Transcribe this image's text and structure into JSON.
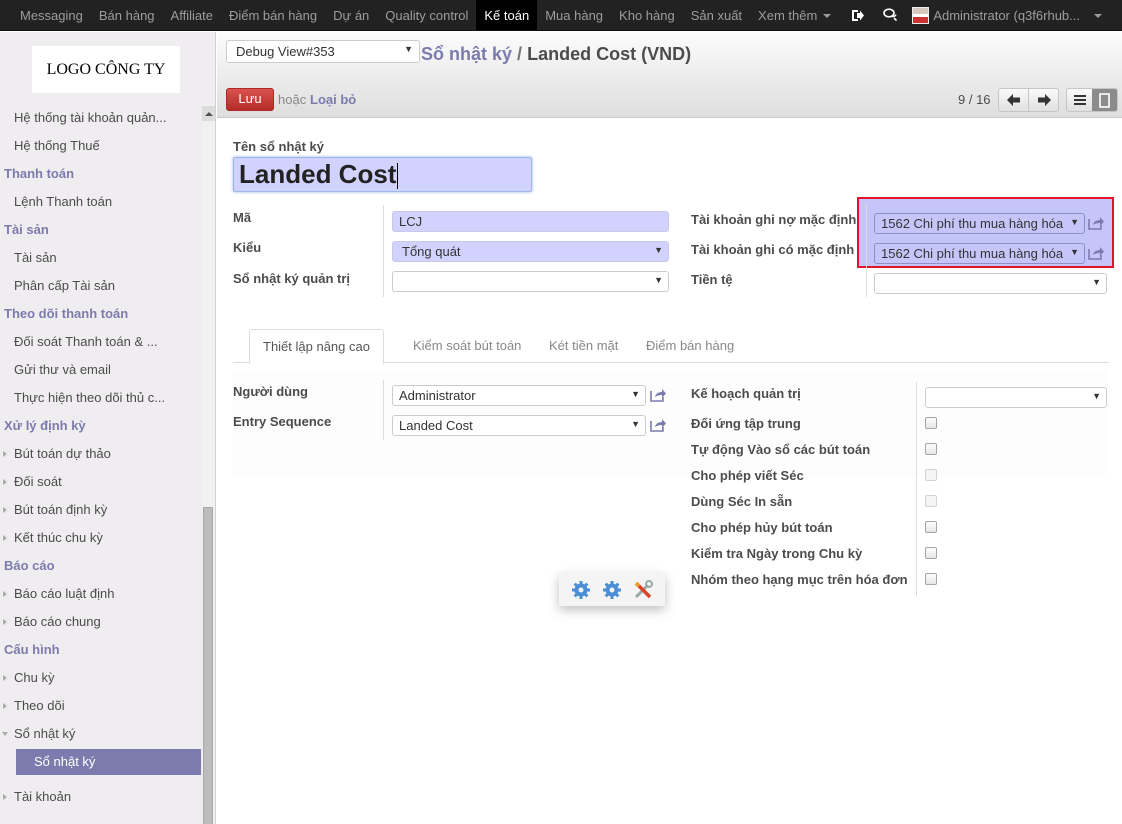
{
  "topnav": {
    "items": [
      {
        "label": "Messaging",
        "active": false
      },
      {
        "label": "Bán hàng",
        "active": false
      },
      {
        "label": "Affiliate",
        "active": false
      },
      {
        "label": "Điểm bán hàng",
        "active": false
      },
      {
        "label": "Dự án",
        "active": false
      },
      {
        "label": "Quality control",
        "active": false
      },
      {
        "label": "Kế toán",
        "active": true
      },
      {
        "label": "Mua hàng",
        "active": false
      },
      {
        "label": "Kho hàng",
        "active": false
      },
      {
        "label": "Sản xuất",
        "active": false
      },
      {
        "label": "Xem thêm",
        "active": false,
        "dropdown": true
      }
    ],
    "user_label": "Administrator (q3f6rhub...",
    "icons": [
      "sign-out-icon",
      "chat-icon"
    ]
  },
  "sidebar": {
    "logo_text": "LOGO CÔNG TY",
    "items": [
      {
        "type": "item",
        "label": "Hệ thống tài khoản quản..."
      },
      {
        "type": "item",
        "label": "Hệ thống Thuế"
      },
      {
        "type": "section",
        "label": "Thanh toán"
      },
      {
        "type": "item",
        "label": "Lệnh Thanh toán"
      },
      {
        "type": "section",
        "label": "Tài sản"
      },
      {
        "type": "item",
        "label": "Tài sản"
      },
      {
        "type": "item",
        "label": "Phân cấp Tài sản"
      },
      {
        "type": "section",
        "label": "Theo dõi thanh toán"
      },
      {
        "type": "item",
        "label": "Đối soát Thanh toán & ..."
      },
      {
        "type": "item",
        "label": "Gửi thư và email"
      },
      {
        "type": "item",
        "label": "Thực hiện theo dõi thủ c..."
      },
      {
        "type": "section",
        "label": "Xử lý định kỳ"
      },
      {
        "type": "expandable",
        "label": "Bút toán dự thảo"
      },
      {
        "type": "expandable",
        "label": "Đối soát"
      },
      {
        "type": "expandable",
        "label": "Bút toán định kỳ"
      },
      {
        "type": "expandable",
        "label": "Kết thúc chu kỳ"
      },
      {
        "type": "section",
        "label": "Báo cáo"
      },
      {
        "type": "expandable",
        "label": "Báo cáo luật định"
      },
      {
        "type": "expandable",
        "label": "Báo cáo chung"
      },
      {
        "type": "section",
        "label": "Cấu hình"
      },
      {
        "type": "expandable",
        "label": "Chu kỳ"
      },
      {
        "type": "expandable",
        "label": "Theo dõi"
      },
      {
        "type": "expanded",
        "label": "Sổ nhật ký"
      },
      {
        "type": "active-sub",
        "label": "Sổ nhật ký"
      },
      {
        "type": "expandable",
        "label": "Tài khoản"
      }
    ]
  },
  "control_panel": {
    "debug_view": "Debug View#353",
    "breadcrumb_parent": "Sổ nhật ký",
    "breadcrumb_sep": "/",
    "breadcrumb_current": "Landed Cost (VND)",
    "save_label": "Lưu",
    "or_text": "hoặc",
    "discard_label": "Loại bỏ",
    "pager": "9 / 16"
  },
  "form": {
    "name_label": "Tên sổ nhật ký",
    "name_value": "Landed Cost",
    "left_fields": [
      {
        "label": "Mã",
        "value": "LCJ"
      },
      {
        "label": "Kiểu",
        "value": "Tổng quát"
      },
      {
        "label": "Sổ nhật ký quản trị",
        "value": ""
      }
    ],
    "right_fields": [
      {
        "label": "Tài khoản ghi nợ mặc định",
        "value": "1562 Chi phí thu mua hàng hóa"
      },
      {
        "label": "Tài khoản ghi có mặc định",
        "value": "1562 Chi phí thu mua hàng hóa"
      },
      {
        "label": "Tiền tệ",
        "value": ""
      }
    ],
    "highlight_color": "#e0142a",
    "tabs": [
      {
        "label": "Thiết lập nâng cao",
        "active": true
      },
      {
        "label": "Kiểm soát bút toán",
        "active": false
      },
      {
        "label": "Két tiền mặt",
        "active": false
      },
      {
        "label": "Điểm bán hàng",
        "active": false
      }
    ],
    "advanced": {
      "left_fields": [
        {
          "label": "Người dùng",
          "value": "Administrator"
        },
        {
          "label": "Entry Sequence",
          "value": "Landed Cost"
        }
      ],
      "analytic_plan_label": "Kế hoạch quản trị",
      "analytic_plan_value": "",
      "checkboxes": [
        {
          "label": "Đối ứng tập trung",
          "checked": false,
          "disabled": false
        },
        {
          "label": "Tự động Vào sổ các bút toán",
          "checked": false,
          "disabled": false
        },
        {
          "label": "Cho phép viết Séc",
          "checked": false,
          "disabled": true
        },
        {
          "label": "Dùng Séc In sẵn",
          "checked": false,
          "disabled": true
        },
        {
          "label": "Cho phép hủy bút toán",
          "checked": false,
          "disabled": false
        },
        {
          "label": "Kiểm tra Ngày trong Chu kỳ",
          "checked": false,
          "disabled": false
        },
        {
          "label": "Nhóm theo hạng mục trên hóa đơn",
          "checked": false,
          "disabled": false
        }
      ]
    }
  },
  "colors": {
    "topbar_bg": "#222222",
    "accent": "#7c7bad",
    "save_button": "#c9302c",
    "required_field": "#d2d2ff"
  },
  "debug_tools": [
    "gear-icon",
    "gear-icon",
    "tools-icon"
  ]
}
